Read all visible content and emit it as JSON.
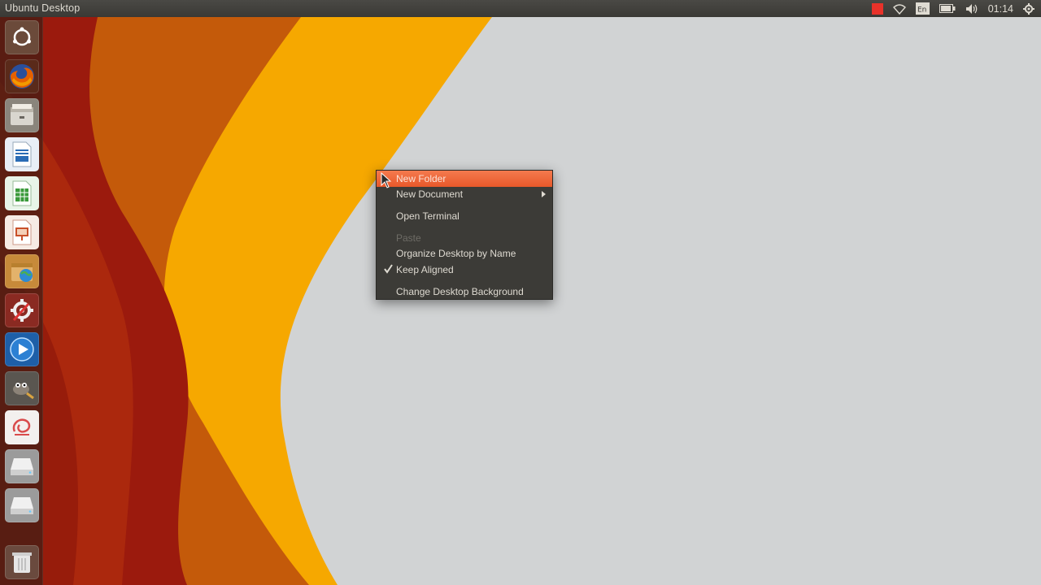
{
  "top_panel": {
    "title": "Ubuntu Desktop",
    "indicators": [
      "record-icon",
      "wifi-icon",
      "keyboard-layout-icon",
      "battery-icon",
      "volume-icon"
    ],
    "keyboard_layout": "En",
    "clock": "01:14",
    "session_icon": "gear-icon"
  },
  "launcher": {
    "items": [
      {
        "name": "dash-icon",
        "color": "#6b4a3a"
      },
      {
        "name": "firefox-icon",
        "color": "#e66000"
      },
      {
        "name": "files-icon",
        "color": "#8a857c"
      },
      {
        "name": "writer-icon",
        "color": "#2b6cb5"
      },
      {
        "name": "calc-icon",
        "color": "#3a9a3a"
      },
      {
        "name": "impress-icon",
        "color": "#c8502a"
      },
      {
        "name": "software-center-icon",
        "color": "#c78a3a"
      },
      {
        "name": "system-settings-icon",
        "color": "#c0392b"
      },
      {
        "name": "media-player-icon",
        "color": "#2c80d3"
      },
      {
        "name": "gimp-icon",
        "color": "#6b6b6b"
      },
      {
        "name": "app-icon",
        "color": "#d94b4b"
      },
      {
        "name": "drive-icon-1",
        "color": "#cfcfcf"
      },
      {
        "name": "drive-icon-2",
        "color": "#cfcfcf"
      },
      {
        "name": "trash-icon",
        "color": "#9a9a9a"
      }
    ]
  },
  "context_menu": {
    "items": [
      {
        "label": "New Folder",
        "state": "highlighted"
      },
      {
        "label": "New Document",
        "submenu": true
      },
      {
        "label": "Open Terminal"
      },
      {
        "label": "Paste",
        "state": "disabled"
      },
      {
        "label": "Organize Desktop by Name"
      },
      {
        "label": "Keep Aligned",
        "checked": true
      },
      {
        "label": "Change Desktop Background"
      }
    ]
  },
  "colors": {
    "accent": "#e95420",
    "panel": "#3c3b37",
    "wallpaper_light": "#d1d3d4",
    "wallpaper_orange": "#f6a800",
    "wallpaper_dark_red": "#9b1a0d"
  }
}
